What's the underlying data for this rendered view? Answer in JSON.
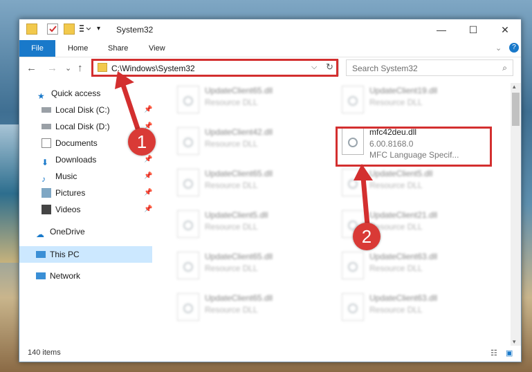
{
  "window": {
    "title": "System32"
  },
  "controls": {
    "minimize": "—",
    "maximize": "☐",
    "close": "✕"
  },
  "ribbon": {
    "tabs": [
      "File",
      "Home",
      "Share",
      "View"
    ]
  },
  "address": {
    "path": "C:\\Windows\\System32",
    "refresh": "↻",
    "dropdown": "⌵"
  },
  "search": {
    "placeholder": "Search System32"
  },
  "nav": {
    "back": "←",
    "forward": "→",
    "recent": "⌄",
    "up": "↑",
    "items": [
      {
        "label": "Quick access",
        "icon": "star-icon"
      },
      {
        "label": "Local Disk (C:)",
        "icon": "drive-icon"
      },
      {
        "label": "Local Disk (D:)",
        "icon": "drive-icon"
      },
      {
        "label": "Documents",
        "icon": "documents-icon"
      },
      {
        "label": "Downloads",
        "icon": "download-icon"
      },
      {
        "label": "Music",
        "icon": "music-icon"
      },
      {
        "label": "Pictures",
        "icon": "pictures-icon"
      },
      {
        "label": "Videos",
        "icon": "videos-icon"
      },
      {
        "label": "OneDrive",
        "icon": "cloud-icon"
      },
      {
        "label": "This PC",
        "icon": "computer-icon"
      },
      {
        "label": "Network",
        "icon": "network-icon"
      }
    ]
  },
  "files": [
    {
      "name": "UpdateClient65.dll",
      "desc": "Resource DLL"
    },
    {
      "name": "UpdateClient19.dll",
      "desc": "Resource DLL"
    },
    {
      "name": "UpdateClient42.dll",
      "desc": "Resource DLL"
    },
    {
      "name": "mfc42deu.dll",
      "desc": "6.00.8168.0",
      "desc2": "MFC Language Specif..."
    },
    {
      "name": "UpdateClient65.dll",
      "desc": "Resource DLL"
    },
    {
      "name": "UpdateClient5.dll",
      "desc": "Resource DLL"
    },
    {
      "name": "UpdateClient5.dll",
      "desc": "Resource DLL"
    },
    {
      "name": "UpdateClient21.dll",
      "desc": "Resource DLL"
    },
    {
      "name": "UpdateClient65.dll",
      "desc": "Resource DLL"
    },
    {
      "name": "UpdateClient63.dll",
      "desc": "Resource DLL"
    },
    {
      "name": "UpdateClient65.dll",
      "desc": "Resource DLL"
    },
    {
      "name": "UpdateClient63.dll",
      "desc": "Resource DLL"
    }
  ],
  "status": {
    "count": "140 items"
  },
  "annotations": {
    "step1": "1",
    "step2": "2",
    "color": "#d32f2f"
  }
}
